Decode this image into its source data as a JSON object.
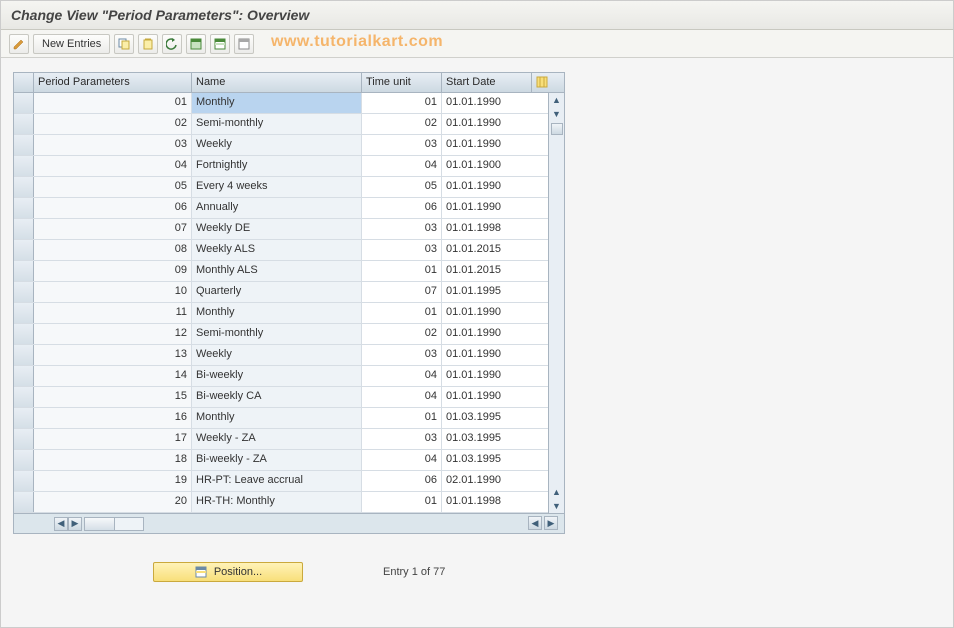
{
  "title": "Change View \"Period Parameters\": Overview",
  "watermark": "www.tutorialkart.com",
  "toolbar": {
    "new_entries_label": "New Entries"
  },
  "table": {
    "headers": {
      "period_parameters": "Period Parameters",
      "name": "Name",
      "time_unit": "Time unit",
      "start_date": "Start Date"
    },
    "rows": [
      {
        "pp": "01",
        "name": "Monthly",
        "tu": "01",
        "date": "01.01.1990",
        "selected": true
      },
      {
        "pp": "02",
        "name": "Semi-monthly",
        "tu": "02",
        "date": "01.01.1990"
      },
      {
        "pp": "03",
        "name": "Weekly",
        "tu": "03",
        "date": "01.01.1990"
      },
      {
        "pp": "04",
        "name": "Fortnightly",
        "tu": "04",
        "date": "01.01.1900"
      },
      {
        "pp": "05",
        "name": "Every 4 weeks",
        "tu": "05",
        "date": "01.01.1990"
      },
      {
        "pp": "06",
        "name": "Annually",
        "tu": "06",
        "date": "01.01.1990"
      },
      {
        "pp": "07",
        "name": "Weekly  DE",
        "tu": "03",
        "date": "01.01.1998"
      },
      {
        "pp": "08",
        "name": "Weekly ALS",
        "tu": "03",
        "date": "01.01.2015"
      },
      {
        "pp": "09",
        "name": "Monthly ALS",
        "tu": "01",
        "date": "01.01.2015"
      },
      {
        "pp": "10",
        "name": "Quarterly",
        "tu": "07",
        "date": "01.01.1995"
      },
      {
        "pp": "11",
        "name": "Monthly",
        "tu": "01",
        "date": "01.01.1990"
      },
      {
        "pp": "12",
        "name": "Semi-monthly",
        "tu": "02",
        "date": "01.01.1990"
      },
      {
        "pp": "13",
        "name": "Weekly",
        "tu": "03",
        "date": "01.01.1990"
      },
      {
        "pp": "14",
        "name": "Bi-weekly",
        "tu": "04",
        "date": "01.01.1990"
      },
      {
        "pp": "15",
        "name": "Bi-weekly CA",
        "tu": "04",
        "date": "01.01.1990"
      },
      {
        "pp": "16",
        "name": "Monthly",
        "tu": "01",
        "date": "01.03.1995"
      },
      {
        "pp": "17",
        "name": "Weekly - ZA",
        "tu": "03",
        "date": "01.03.1995"
      },
      {
        "pp": "18",
        "name": "Bi-weekly - ZA",
        "tu": "04",
        "date": "01.03.1995"
      },
      {
        "pp": "19",
        "name": "HR-PT: Leave accrual",
        "tu": "06",
        "date": "02.01.1990"
      },
      {
        "pp": "20",
        "name": "HR-TH: Monthly",
        "tu": "01",
        "date": "01.01.1998"
      }
    ]
  },
  "footer": {
    "position_label": "Position...",
    "entry_text": "Entry 1 of 77"
  }
}
